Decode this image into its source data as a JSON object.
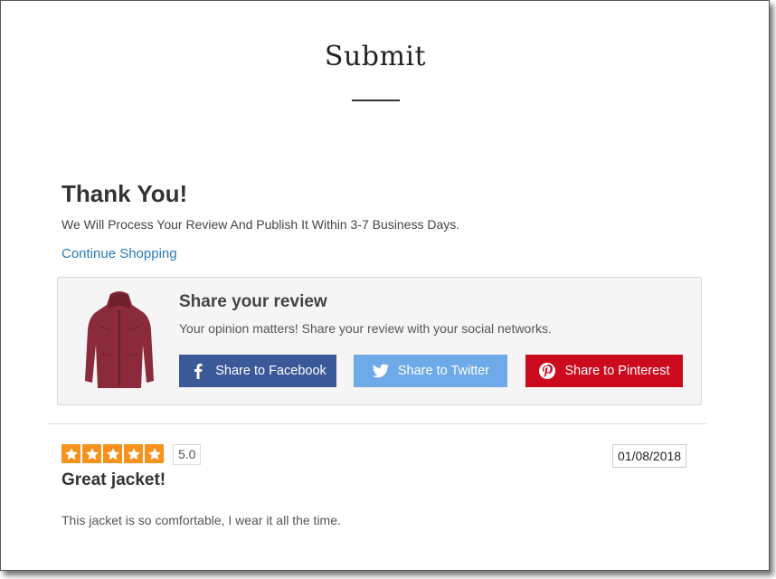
{
  "modal": {
    "title": "Submit"
  },
  "thanks": {
    "heading": "Thank You!",
    "message": "We Will Process Your Review And Publish It Within 3-7 Business Days.",
    "continue_link": "Continue Shopping"
  },
  "share": {
    "heading": "Share your review",
    "subtext": "Your opinion matters! Share your review with your social networks.",
    "buttons": [
      {
        "label": "Share to Facebook",
        "icon": "facebook-icon",
        "color": "#3b5998"
      },
      {
        "label": "Share to Twitter",
        "icon": "twitter-icon",
        "color": "#6ea9e8"
      },
      {
        "label": "Share to Pinterest",
        "icon": "pinterest-icon",
        "color": "#cc0a1e"
      }
    ],
    "product_image": "red-jacket"
  },
  "review": {
    "stars": 5,
    "star_color": "#f7931d",
    "rating": "5.0",
    "date": "01/08/2018",
    "title": "Great jacket!",
    "body": "This jacket is so comfortable, I wear it all the time."
  },
  "colors": {
    "link": "#2a7ab8"
  }
}
